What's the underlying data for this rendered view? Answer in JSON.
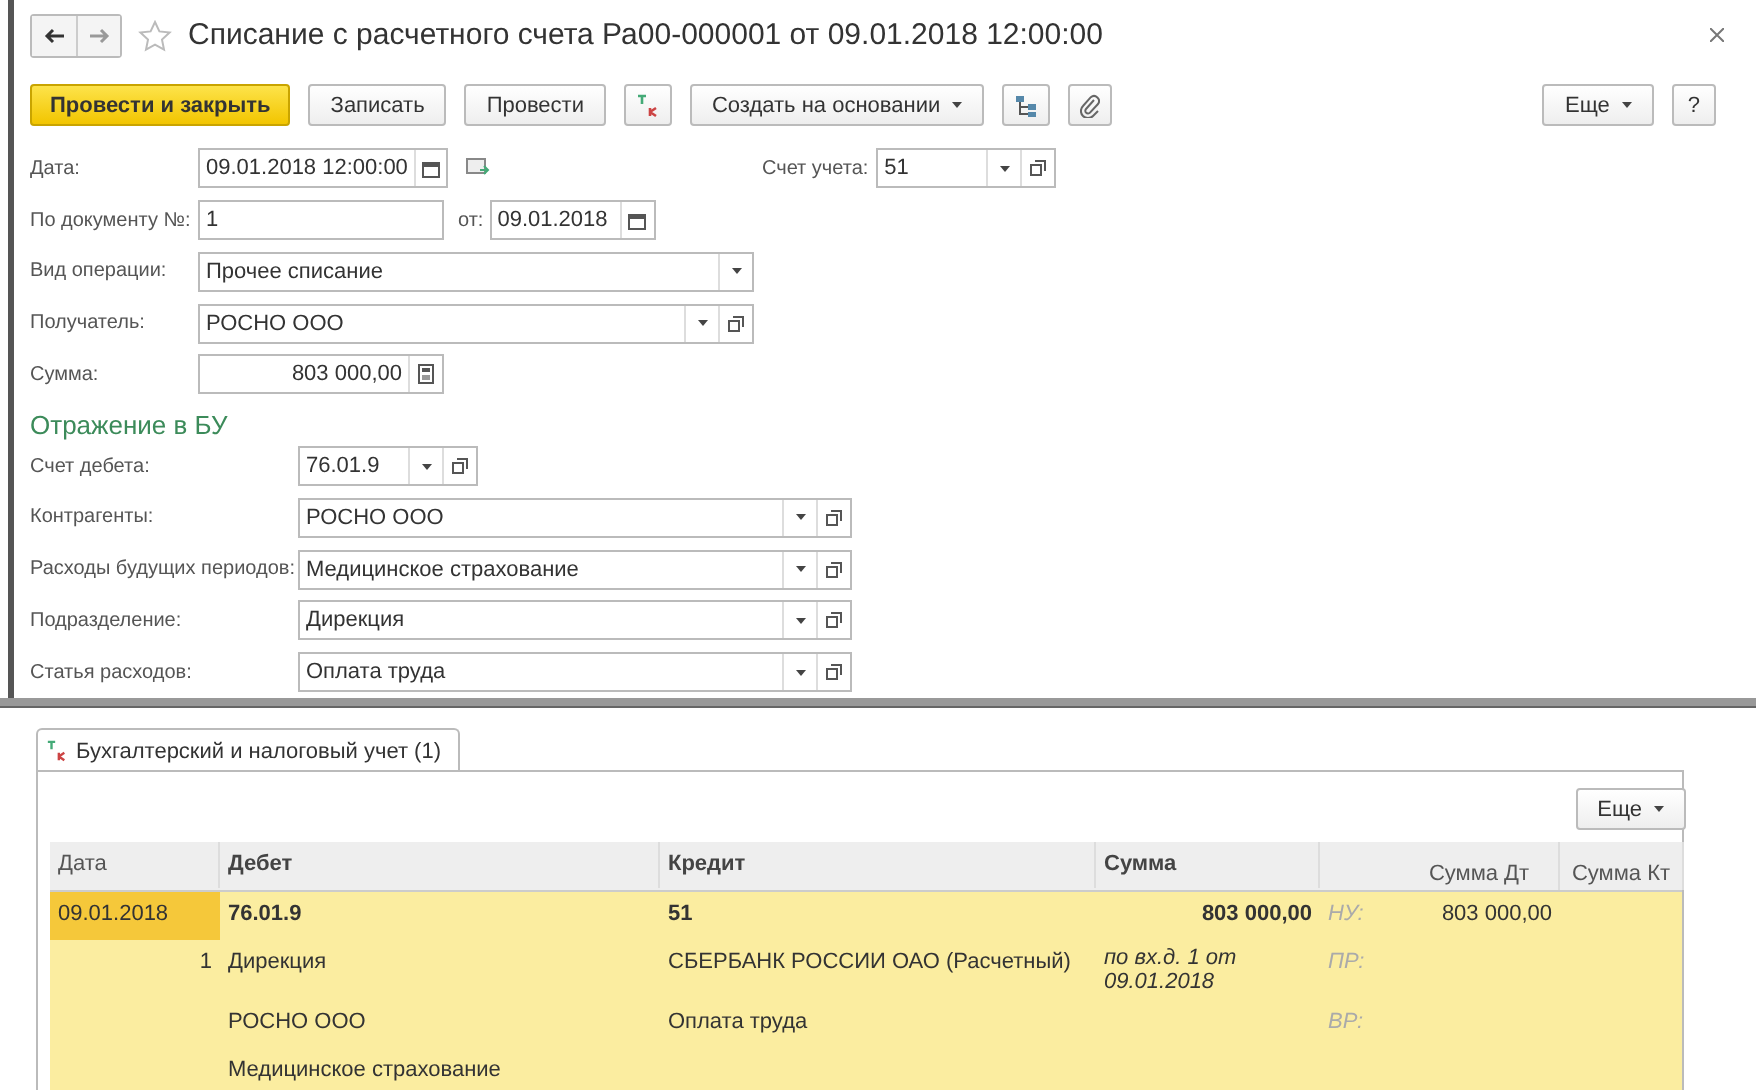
{
  "window": {
    "title": "Списание с расчетного счета Ра00-000001 от 09.01.2018 12:00:00",
    "favorite": false
  },
  "toolbar": [
    {
      "kind": "primary",
      "label": "Провести и закрыть"
    },
    {
      "kind": "plain",
      "label": "Записать"
    },
    {
      "kind": "plain",
      "label": "Провести"
    },
    {
      "kind": "dtkt"
    },
    {
      "kind": "menu",
      "label": "Создать на основании"
    },
    {
      "kind": "structure"
    },
    {
      "kind": "attach"
    }
  ],
  "toolbar_right": {
    "more": "Еще",
    "help": "?"
  },
  "header": {
    "date": {
      "label": "Дата:",
      "value": "09.01.2018 12:00:00"
    },
    "account": {
      "label": "Счет учета:",
      "value": "51"
    },
    "doc_number": {
      "label": "По документу №:",
      "value": "1"
    },
    "doc_date": {
      "label": "от:",
      "value": "09.01.2018"
    },
    "operation": {
      "label": "Вид операции:",
      "value": "Прочее списание"
    },
    "recipient": {
      "label": "Получатель:",
      "value": "РОСНО ООО"
    },
    "amount": {
      "label": "Сумма:",
      "value": "803 000,00"
    }
  },
  "bu_section": {
    "title": "Отражение в БУ",
    "fields": [
      {
        "kind": "account",
        "label": "Счет дебета:",
        "value": "76.01.9"
      },
      {
        "kind": "reference",
        "label": "Контрагенты:",
        "value": "РОСНО ООО"
      },
      {
        "kind": "reference",
        "label": "Расходы будущих периодов:",
        "value": "Медицинское страхование"
      },
      {
        "kind": "reference",
        "label": "Подразделение:",
        "value": "Дирекция"
      },
      {
        "kind": "reference",
        "label": "Статья расходов:",
        "value": "Оплата труда"
      }
    ]
  },
  "tabs": [
    {
      "label": "Бухгалтерский и налоговый учет (1)",
      "selected": true
    }
  ],
  "table_more": "Еще",
  "table": {
    "columns": {
      "date": "Дата",
      "debit": "Дебет",
      "credit": "Кредит",
      "amount": "Сумма",
      "amount_dt": "Сумма Дт",
      "amount_kt": "Сумма Кт"
    },
    "rows": [
      {
        "selected": true,
        "date_focused": true,
        "lines": [
          {
            "date": "09.01.2018",
            "debit": "76.01.9",
            "credit": "51",
            "amount": "803 000,00",
            "register": "НУ:",
            "amount_dt": "803 000,00"
          },
          {
            "date": "1",
            "debit": "Дирекция",
            "credit": "СБЕРБАНК РОССИИ ОАО (Расчетный)",
            "amount": "по вх.д. 1 от 09.01.2018",
            "register": "ПР:"
          },
          {
            "debit": "РОСНО ООО",
            "credit": "Оплата труда",
            "register": "ВР:"
          },
          {
            "debit": "Медицинское страхование"
          }
        ]
      }
    ]
  }
}
